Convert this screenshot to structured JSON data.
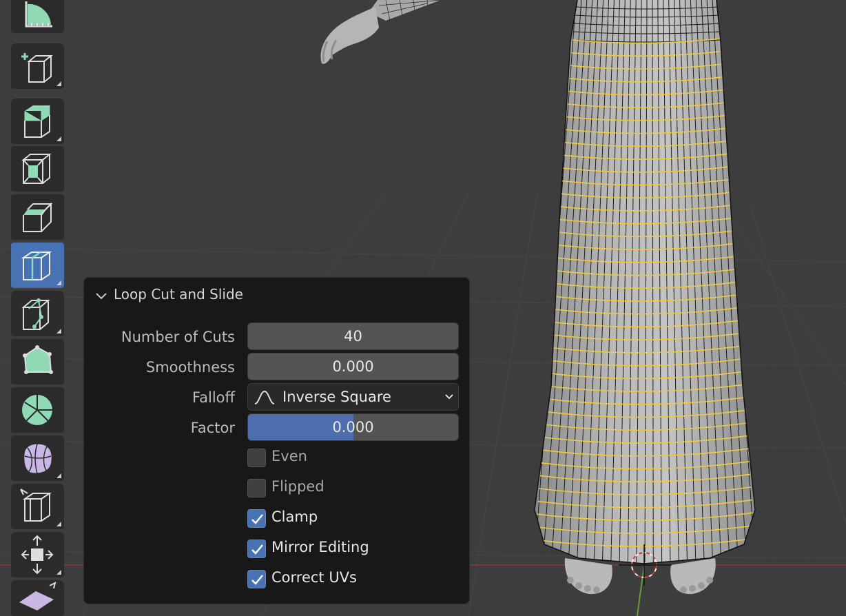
{
  "toolbar": {
    "tools": [
      {
        "name": "measure-tool-icon"
      },
      {
        "name": "add-cube-tool-icon"
      },
      {
        "name": "extrude-region-tool-icon"
      },
      {
        "name": "inset-faces-tool-icon"
      },
      {
        "name": "bevel-tool-icon"
      },
      {
        "name": "loop-cut-tool-icon",
        "active": true
      },
      {
        "name": "knife-tool-icon"
      },
      {
        "name": "poly-build-tool-icon"
      },
      {
        "name": "spin-tool-icon"
      },
      {
        "name": "smooth-tool-icon"
      },
      {
        "name": "edge-slide-tool-icon"
      },
      {
        "name": "shrink-fatten-tool-icon"
      },
      {
        "name": "shear-tool-icon"
      }
    ]
  },
  "panel": {
    "title": "Loop Cut and Slide",
    "number_of_cuts": {
      "label": "Number of Cuts",
      "value": "40"
    },
    "smoothness": {
      "label": "Smoothness",
      "value": "0.000"
    },
    "falloff": {
      "label": "Falloff",
      "value": "Inverse Square"
    },
    "factor": {
      "label": "Factor",
      "value": "0.000",
      "fill_fraction": 0.5
    },
    "even": {
      "label": "Even",
      "checked": false
    },
    "flipped": {
      "label": "Flipped",
      "checked": false
    },
    "clamp": {
      "label": "Clamp",
      "checked": true
    },
    "mirror_editing": {
      "label": "Mirror Editing",
      "checked": true
    },
    "correct_uvs": {
      "label": "Correct UVs",
      "checked": true
    }
  },
  "colors": {
    "viewport_bg": "#3d3d3d",
    "active_tool": "#4772b3",
    "loop_cut_edges": "#f0c93a",
    "factor_fill": "#4f6eb0"
  }
}
